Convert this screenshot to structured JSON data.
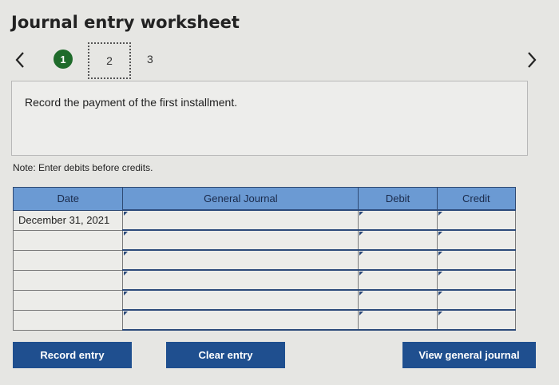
{
  "page": {
    "title": "Journal entry worksheet"
  },
  "stepper": {
    "steps": [
      "1",
      "2",
      "3"
    ],
    "current": "1"
  },
  "instruction": {
    "text": "Record the payment of the first installment."
  },
  "note": {
    "text": "Note: Enter debits before credits."
  },
  "table": {
    "headers": {
      "date": "Date",
      "general_journal": "General Journal",
      "debit": "Debit",
      "credit": "Credit"
    },
    "rows": [
      {
        "date": "December 31, 2021",
        "account": "",
        "debit": "",
        "credit": ""
      },
      {
        "date": "",
        "account": "",
        "debit": "",
        "credit": ""
      },
      {
        "date": "",
        "account": "",
        "debit": "",
        "credit": ""
      },
      {
        "date": "",
        "account": "",
        "debit": "",
        "credit": ""
      },
      {
        "date": "",
        "account": "",
        "debit": "",
        "credit": ""
      },
      {
        "date": "",
        "account": "",
        "debit": "",
        "credit": ""
      }
    ]
  },
  "buttons": {
    "record": "Record entry",
    "clear": "Clear entry",
    "view": "View general journal"
  },
  "colors": {
    "header_bg": "#6b9ad3",
    "button_bg": "#1f4f8f",
    "active_step": "#1f6b2b"
  },
  "icons": {
    "prev": "chevron-left-icon",
    "next": "chevron-right-icon"
  }
}
